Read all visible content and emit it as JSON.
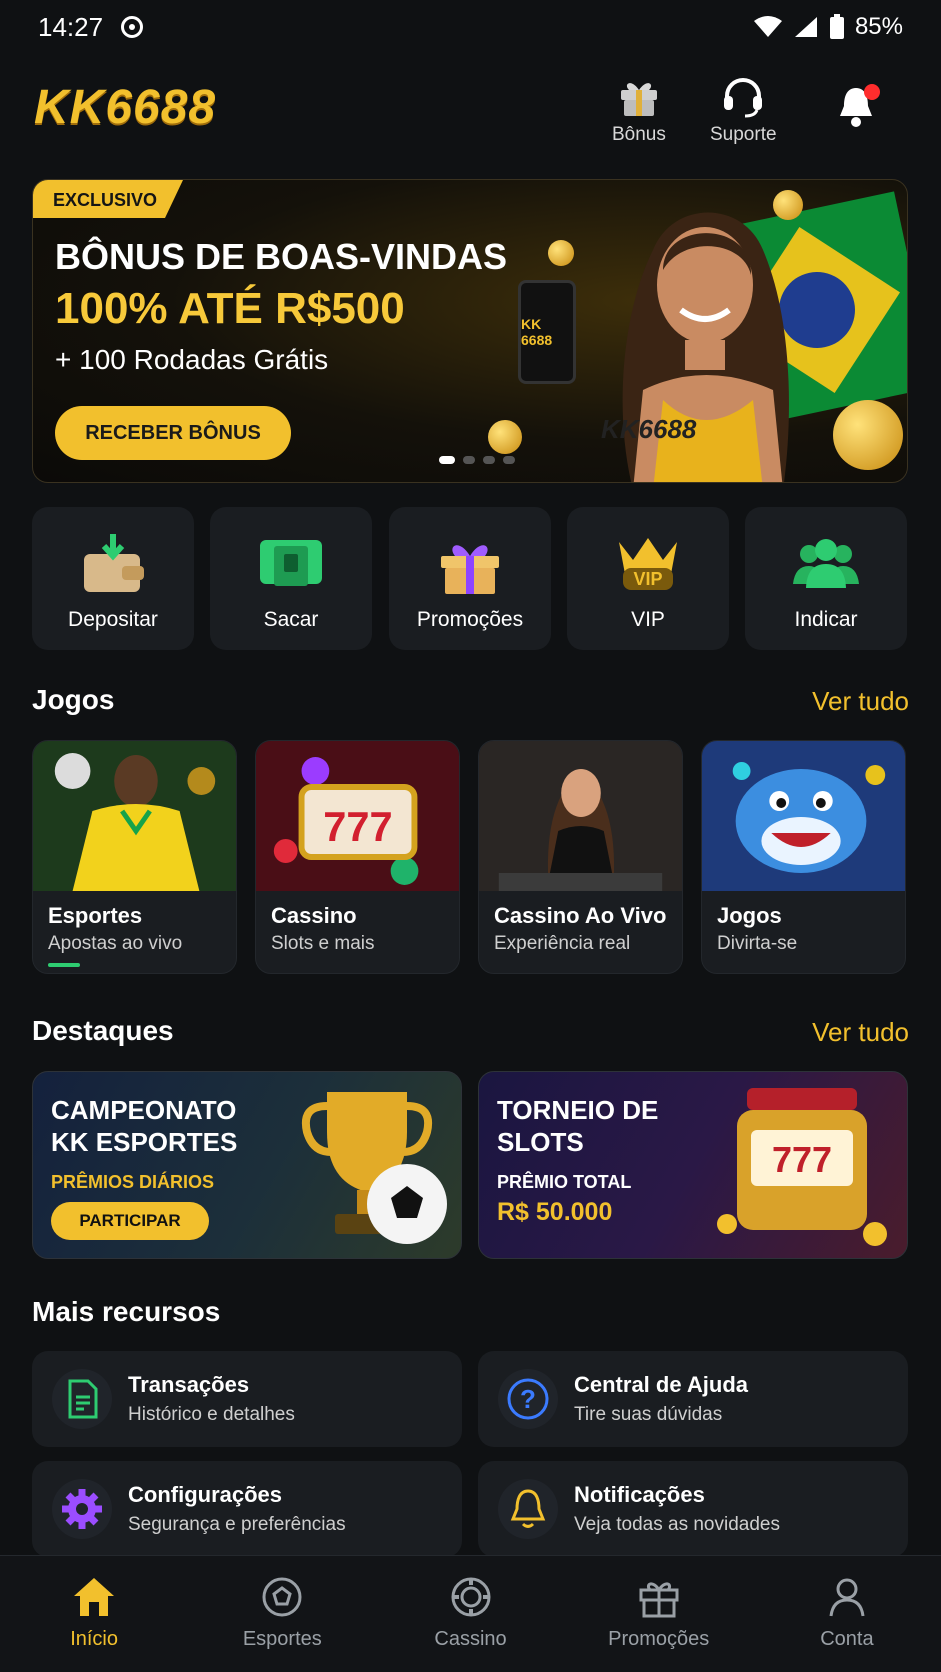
{
  "status": {
    "time": "14:27",
    "battery": "85%"
  },
  "header": {
    "logo": "KK6688",
    "bonus_label": "Bônus",
    "support_label": "Suporte"
  },
  "hero": {
    "tag": "EXCLUSIVO",
    "line1": "BÔNUS DE BOAS-VINDAS",
    "line2": "100% ATÉ R$500",
    "line3": "+ 100 Rodadas Grátis",
    "button": "RECEBER BÔNUS",
    "phone_logo": "KK 6688",
    "shirt_text": "KK6688",
    "slide_index": 1,
    "slide_count": 4
  },
  "quick_actions": [
    {
      "label": "Depositar",
      "icon": "wallet-download-icon"
    },
    {
      "label": "Sacar",
      "icon": "cash-withdraw-icon"
    },
    {
      "label": "Promoções",
      "icon": "gift-box-icon"
    },
    {
      "label": "VIP",
      "icon": "vip-crown-icon"
    },
    {
      "label": "Indicar",
      "icon": "users-group-icon"
    }
  ],
  "games_section": {
    "title": "Jogos",
    "see_all": "Ver tudo",
    "items": [
      {
        "title": "Esportes",
        "subtitle": "Apostas ao vivo"
      },
      {
        "title": "Cassino",
        "subtitle": "Slots e mais"
      },
      {
        "title": "Cassino Ao Vivo",
        "subtitle": "Experiência real"
      },
      {
        "title": "Jogos",
        "subtitle": "Divirta-se"
      }
    ]
  },
  "highlights": {
    "title": "Destaques",
    "see_all": "Ver tudo",
    "cards": [
      {
        "title_line1": "CAMPEONATO",
        "title_line2": "KK ESPORTES",
        "subtitle": "PRÊMIOS DIÁRIOS",
        "button": "PARTICIPAR"
      },
      {
        "title_line1": "TORNEIO DE",
        "title_line2": "SLOTS",
        "subtitle": "PRÊMIO TOTAL",
        "value": "R$ 50.000"
      }
    ]
  },
  "more": {
    "title": "Mais recursos",
    "items": [
      {
        "title": "Transações",
        "subtitle": "Histórico e detalhes",
        "icon": "document-icon"
      },
      {
        "title": "Central de Ajuda",
        "subtitle": "Tire suas dúvidas",
        "icon": "help-icon"
      },
      {
        "title": "Configurações",
        "subtitle": "Segurança e preferências",
        "icon": "gear-icon"
      },
      {
        "title": "Notificações",
        "subtitle": "Veja todas as novidades",
        "icon": "bell-icon"
      }
    ]
  },
  "bottom_nav": [
    {
      "label": "Início",
      "icon": "home-icon",
      "active": true
    },
    {
      "label": "Esportes",
      "icon": "soccer-ball-icon"
    },
    {
      "label": "Cassino",
      "icon": "casino-chip-icon"
    },
    {
      "label": "Promoções",
      "icon": "gift-icon"
    },
    {
      "label": "Conta",
      "icon": "user-icon"
    }
  ],
  "colors": {
    "accent": "#f2c02d",
    "background": "#0f1113",
    "card": "#1a1d21",
    "notification_dot": "#ff2d2d"
  }
}
